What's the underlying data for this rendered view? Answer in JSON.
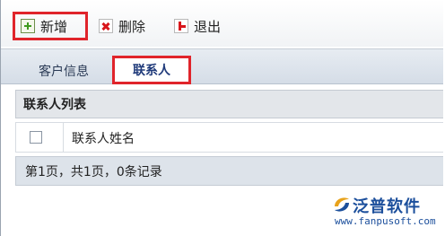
{
  "toolbar": {
    "add_label": "新增",
    "delete_label": "删除",
    "exit_label": "退出"
  },
  "tabs": [
    {
      "label": "客户信息",
      "active": false
    },
    {
      "label": "联系人",
      "active": true
    }
  ],
  "panel": {
    "title": "联系人列表",
    "columns": [
      "联系人姓名"
    ],
    "rows": [],
    "pager_text": "第1页，共1页，0条记录"
  },
  "watermark": {
    "brand": "泛普软件",
    "url": "www.fanpusoft.com"
  },
  "colors": {
    "highlight_border": "#e0242b",
    "brand_blue": "#1c4f9c",
    "tab_bar": "#dbe2ea"
  }
}
